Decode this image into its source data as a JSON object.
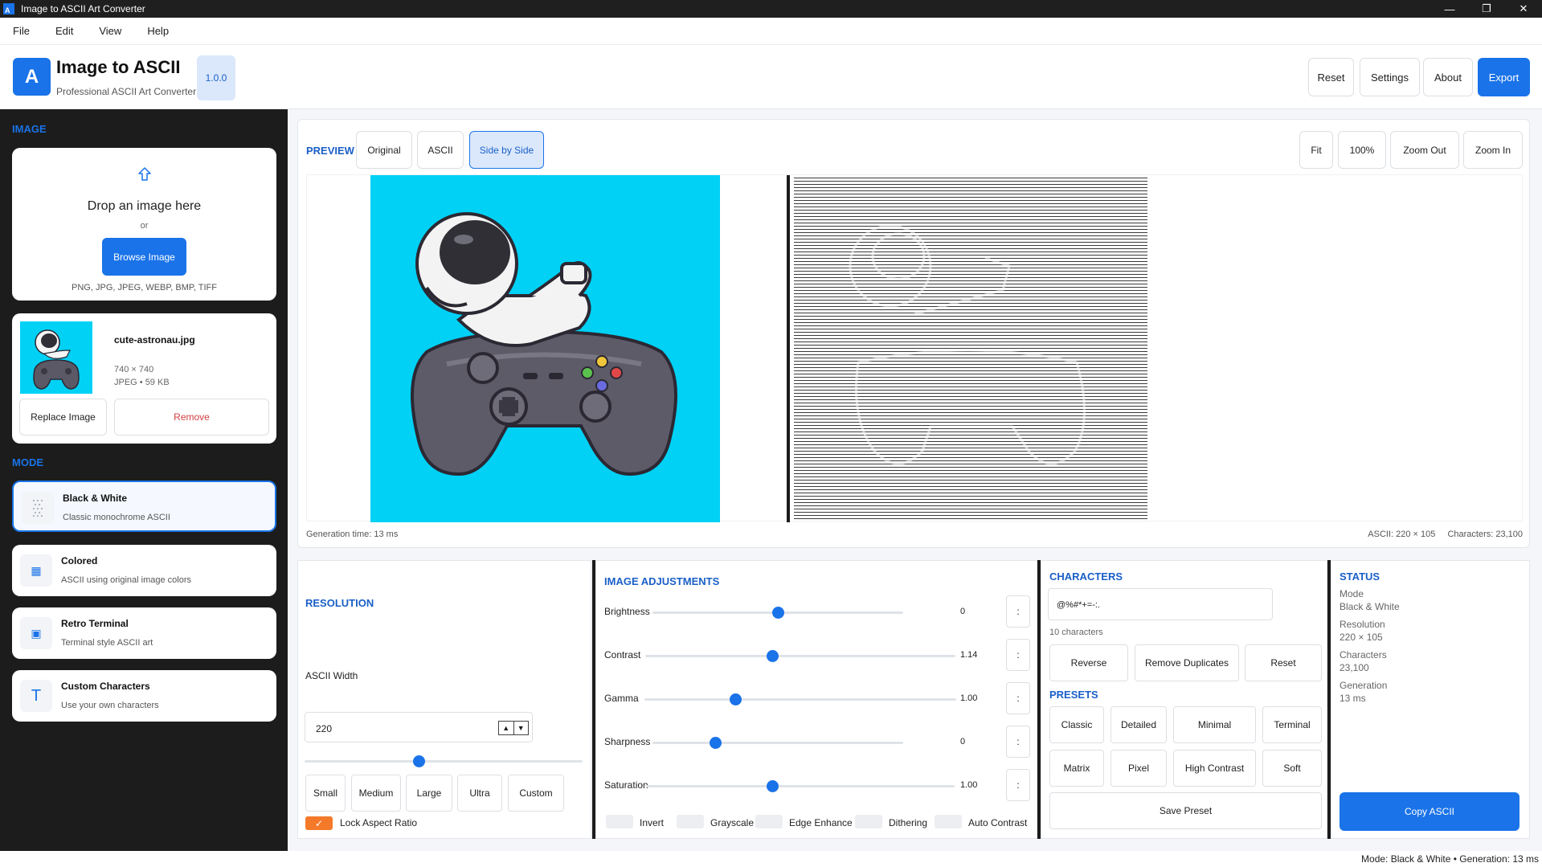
{
  "window": {
    "title": "Image to ASCII Art Converter",
    "icon_letter": "A"
  },
  "menu": [
    "File",
    "Edit",
    "View",
    "Help"
  ],
  "header": {
    "logo_letter": "A",
    "app_name": "Image to ASCII",
    "subtitle": "Professional ASCII Art Converter",
    "version": "1.0.0",
    "buttons": {
      "reset": "Reset",
      "settings": "Settings",
      "about": "About",
      "export": "Export"
    }
  },
  "sidebar": {
    "image_label": "IMAGE",
    "drop": {
      "title": "Drop an image here",
      "or": "or",
      "browse": "Browse Image",
      "formats": "PNG, JPG, JPEG, WEBP, BMP, TIFF"
    },
    "file": {
      "name": "cute-astronau.jpg",
      "dimensions": "740 × 740",
      "meta": "JPEG • 59 KB",
      "replace": "Replace Image",
      "remove": "Remove"
    },
    "mode_label": "MODE",
    "modes": [
      {
        "title": "Black & White",
        "desc": "Classic monochrome ASCII",
        "icon": "dotted-grid-icon"
      },
      {
        "title": "Colored",
        "desc": "ASCII using original image colors",
        "icon": "grid-icon"
      },
      {
        "title": "Retro Terminal",
        "desc": "Terminal style ASCII art",
        "icon": "terminal-icon"
      },
      {
        "title": "Custom Characters",
        "desc": "Use your own characters",
        "icon": "T"
      }
    ]
  },
  "preview": {
    "label": "PREVIEW",
    "tabs": {
      "original": "Original",
      "ascii": "ASCII",
      "side": "Side by Side"
    },
    "zoom": {
      "fit": "Fit",
      "percent": "100%",
      "zoom_out": "Zoom Out",
      "zoom_in": "Zoom In"
    },
    "generation": "Generation time: 13 ms",
    "ascii_size": "ASCII: 220 × 105",
    "characters": "Characters: 23,100"
  },
  "resolution": {
    "title": "RESOLUTION",
    "width_label": "ASCII Width",
    "width_value": "220",
    "slider_level": 0.41,
    "sizes": [
      "Small",
      "Medium",
      "Large",
      "Ultra",
      "Custom"
    ],
    "lock_label": "Lock Aspect Ratio",
    "lock_checked": true
  },
  "adjustments": {
    "title": "IMAGE ADJUSTMENTS",
    "items": [
      {
        "label": "Brightness",
        "value": "0",
        "level": 0.5
      },
      {
        "label": "Contrast",
        "value": "1.14",
        "level": 0.41
      },
      {
        "label": "Gamma",
        "value": "1.00",
        "level": 0.29
      },
      {
        "label": "Sharpness",
        "value": "0",
        "level": 0.25
      },
      {
        "label": "Saturation",
        "value": "1.00",
        "level": 0.41
      }
    ],
    "dots": ":",
    "toggles": [
      "Invert",
      "Grayscale",
      "Edge Enhance",
      "Dithering",
      "Auto Contrast"
    ]
  },
  "characters": {
    "title": "CHARACTERS",
    "value": "@%#*+=-:.",
    "count": "10 characters",
    "reverse": "Reverse",
    "remove_dup": "Remove Duplicates",
    "reset": "Reset",
    "presets_title": "PRESETS",
    "presets": [
      "Classic",
      "Detailed",
      "Minimal",
      "Terminal",
      "Matrix",
      "Pixel",
      "High Contrast",
      "Soft"
    ],
    "save_preset": "Save Preset"
  },
  "status": {
    "title": "STATUS",
    "mode_key": "Mode",
    "mode_val": "Black & White",
    "res_key": "Resolution",
    "res_val": "220 × 105",
    "chars_key": "Characters",
    "chars_val": "23,100",
    "gen_key": "Generation",
    "gen_val": "13 ms",
    "copy": "Copy ASCII"
  },
  "statusbar": "Mode: Black & White • Generation: 13 ms",
  "colors": {
    "accent": "#1a73e8",
    "sidebar": "#1c1c1c",
    "image_bg": "#00d1f5",
    "check": "#f47a2a"
  }
}
